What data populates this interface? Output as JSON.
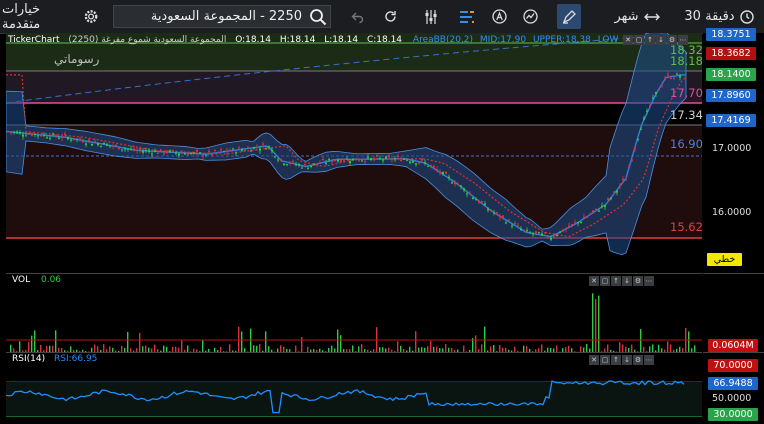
{
  "toolbar": {
    "timeframe": "30 دقيقة",
    "range": "شهر",
    "symbol": "2250 - المجموعة السعودية",
    "advanced_options": "خيارات متقدمة"
  },
  "chart_header": {
    "brand": "TickerChart",
    "symbol_info": "(2250) المجموعة السعودية  شموع مفرغة",
    "open": "O:18.14",
    "high": "H:18.14",
    "low": "L:18.14",
    "close": "C:18.14",
    "indicator": "AreaBB(20,2)",
    "mid": "MID:17.90",
    "upper": "UPPER:18.38",
    "lower": "LOW",
    "drawings_label": "رسوماتي"
  },
  "price_axis": {
    "ticks": [
      "17.0000",
      "16.0000"
    ],
    "labels": [
      {
        "text": "18.3751",
        "color": "#1e66c9"
      },
      {
        "text": "18.3682",
        "color": "#b01010"
      },
      {
        "text": "18.1400",
        "color": "#2aa34a"
      },
      {
        "text": "17.8960",
        "color": "#1e66c9"
      },
      {
        "text": "17.4169",
        "color": "#1e66c9"
      }
    ],
    "linear_label": "خطي"
  },
  "price_markers": [
    {
      "text": "18.32",
      "color": "#5fbf4a"
    },
    {
      "text": "18.18",
      "color": "#5fbf4a"
    },
    {
      "text": "17.70",
      "color": "#e04fa0"
    },
    {
      "text": "17.34",
      "color": "#cfcfcf"
    },
    {
      "text": "16.90",
      "color": "#4f7fe0"
    },
    {
      "text": "15.62",
      "color": "#e04040"
    }
  ],
  "volume": {
    "label": "VOL",
    "value": "0.06",
    "axis_label": "0.0604M"
  },
  "rsi": {
    "label": "RSI(14)",
    "value": "RSI:66.95",
    "labels": [
      {
        "text": "70.0000",
        "color": "#c01010"
      },
      {
        "text": "66.9488",
        "color": "#1e66c9"
      },
      {
        "text": "30.0000",
        "color": "#2aa34a"
      }
    ],
    "mid_tick": "50.0000"
  },
  "colors": {
    "up": "#2ecc40",
    "down": "#e0303a",
    "band": "#1e4f8c",
    "mid": "#2f7fe0",
    "rsi": "#1e8fff"
  }
}
